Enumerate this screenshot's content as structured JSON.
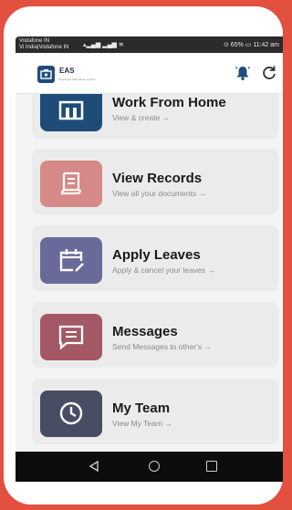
{
  "statusbar": {
    "carrier": "Vodafone IN",
    "carrier2": "Vi India|Vodafone IN",
    "signal": "▴▂▄▆ ▂▄▆ ≋",
    "right": "⊙ 65% ▭ 11:42 am"
  },
  "appbar": {
    "title": "EAS",
    "subtitle": "Employee Attendance System",
    "bell_icon": "bell-icon",
    "refresh_icon": "refresh-icon"
  },
  "menu": [
    {
      "title": "Work From Home",
      "subtitle": "View & create →",
      "color": "#1e4c78",
      "icon": "building-icon"
    },
    {
      "title": "View Records",
      "subtitle": "View all your documents →",
      "color": "#d58a87",
      "icon": "document-icon"
    },
    {
      "title": "Apply Leaves",
      "subtitle": "Apply & cancel your leaves →",
      "color": "#6a6a9a",
      "icon": "calendar-edit-icon"
    },
    {
      "title": "Messages",
      "subtitle": "Send Messages to other's →",
      "color": "#a45866",
      "icon": "message-icon"
    },
    {
      "title": "My Team",
      "subtitle": "View My Team →",
      "color": "#474d62",
      "icon": "clock-icon"
    }
  ],
  "colors": {
    "background": "#e2513f",
    "statusbar": "#2b2b2b",
    "navbar": "#0d0d0d",
    "bell": "#1e4c78"
  }
}
